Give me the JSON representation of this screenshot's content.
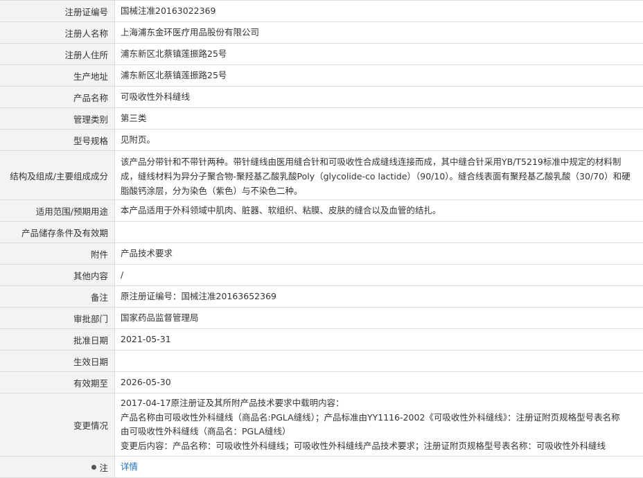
{
  "rows": [
    {
      "label": "注册证编号",
      "value": "国械注准20163022369"
    },
    {
      "label": "注册人名称",
      "value": "上海浦东金环医疗用品股份有限公司"
    },
    {
      "label": "注册人住所",
      "value": "浦东新区北蔡镇莲振路25号"
    },
    {
      "label": "生产地址",
      "value": "浦东新区北蔡镇莲振路25号"
    },
    {
      "label": "产品名称",
      "value": "可吸收性外科缝线"
    },
    {
      "label": "管理类别",
      "value": "第三类"
    },
    {
      "label": "型号规格",
      "value": "见附页。"
    },
    {
      "label": "结构及组成/主要组成成分",
      "value": "该产品分带针和不带针两种。带针缝线由医用缝合针和可吸收性合成缝线连接而成，其中缝合针采用YB/T5219标准中规定的材料制成，缝线材料为异分子聚合物-聚羟基乙酸乳酸Poly（glycolide-co lactide）（90/10）。缝合线表面有聚羟基乙酸乳酸（30/70）和硬脂酸钙涂层，分为染色（紫色）与不染色二种。"
    },
    {
      "label": "适用范围/预期用途",
      "value": "本产品适用于外科领域中肌肉、脏器、软组织、粘膜、皮肤的缝合以及血管的结扎。"
    },
    {
      "label": "产品储存条件及有效期",
      "value": ""
    },
    {
      "label": "附件",
      "value": "产品技术要求"
    },
    {
      "label": "其他内容",
      "value": "/"
    },
    {
      "label": "备注",
      "value": "原注册证编号：国械注准20163652369"
    },
    {
      "label": "审批部门",
      "value": "国家药品监督管理局"
    },
    {
      "label": "批准日期",
      "value": "2021-05-31"
    },
    {
      "label": "生效日期",
      "value": ""
    },
    {
      "label": "有效期至",
      "value": "2026-05-30"
    }
  ],
  "change": {
    "label": "变更情况",
    "lines": [
      "2017-04-17原注册证及其所附产品技术要求中载明内容：",
      "产品名称由可吸收性外科缝线（商品名:PGLA缝线）；产品标准由YY1116-2002《可吸收性外科缝线》：注册证附页规格型号表名称",
      "由可吸收性外科缝线（商品名：PGLA缝线）",
      "变更后内容：产品名称：可吸收性外科缝线；可吸收性外科缝线产品技术要求；注册证附页规格型号表名称：可吸收性外科缝线"
    ]
  },
  "note": {
    "label": "注",
    "link_text": "详情"
  }
}
